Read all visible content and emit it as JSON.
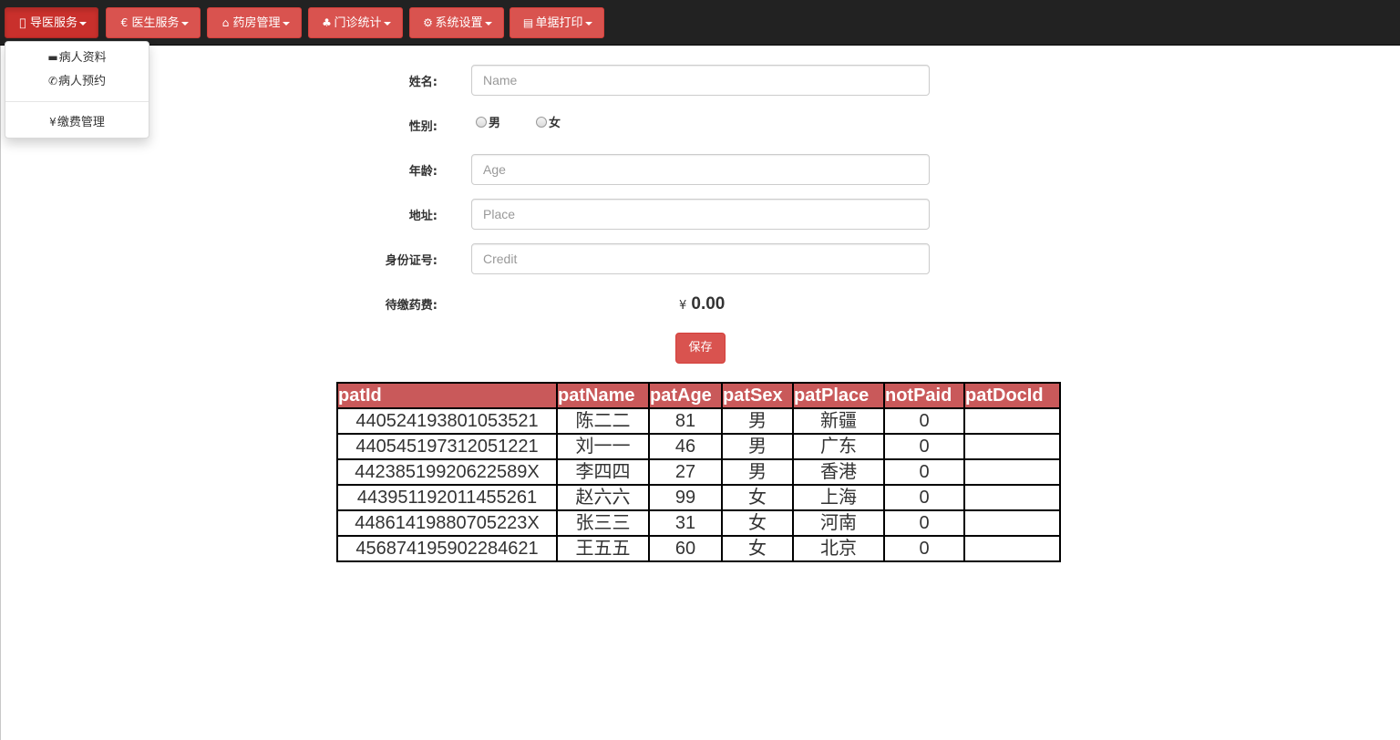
{
  "nav": {
    "items": [
      {
        "label": "导医服务",
        "icon": "apple-icon"
      },
      {
        "label": "医生服务",
        "icon": "euro-icon"
      },
      {
        "label": "药房管理",
        "icon": "home-icon"
      },
      {
        "label": "门诊统计",
        "icon": "tree-icon"
      },
      {
        "label": "系统设置",
        "icon": "gear-icon"
      },
      {
        "label": "单据打印",
        "icon": "print-icon"
      }
    ],
    "active_index": 0,
    "dropdown": [
      {
        "label": "病人资料",
        "icon": "credit-card-icon"
      },
      {
        "label": "病人预约",
        "icon": "phone-icon"
      },
      {
        "label": "缴费管理",
        "icon": "yen-icon"
      }
    ]
  },
  "form": {
    "name_label": "姓名:",
    "name_placeholder": "Name",
    "name_value": "",
    "sex_label": "性别:",
    "sex_options": [
      "男",
      "女"
    ],
    "age_label": "年龄:",
    "age_placeholder": "Age",
    "place_label": "地址:",
    "place_placeholder": "Place",
    "credit_label": "身份证号:",
    "credit_placeholder": "Credit",
    "unpaid_label": "待缴药费:",
    "currency_symbol": "¥",
    "unpaid_amount": "0.00",
    "save_label": "保存"
  },
  "table": {
    "headers": [
      "patId",
      "patName",
      "patAge",
      "patSex",
      "patPlace",
      "notPaid",
      "patDocId"
    ],
    "rows": [
      [
        "44052419380105352​1",
        "陈二二",
        "81",
        "男",
        "新疆",
        "0",
        ""
      ],
      [
        "440545197312051221",
        "刘一一",
        "46",
        "男",
        "广东",
        "0",
        ""
      ],
      [
        "44238519920622589X",
        "李四四",
        "27",
        "男",
        "香港",
        "0",
        ""
      ],
      [
        "443951192011455261",
        "赵六六",
        "99",
        "女",
        "上海",
        "0",
        ""
      ],
      [
        "44861419880705223X",
        "张三三",
        "31",
        "女",
        "河南",
        "0",
        ""
      ],
      [
        "456874195902284621",
        "王五五",
        "60",
        "女",
        "北京",
        "0",
        ""
      ]
    ]
  },
  "colors": {
    "navbar": "#222222",
    "button_danger": "#d9534f",
    "table_header": "#c9595a"
  }
}
